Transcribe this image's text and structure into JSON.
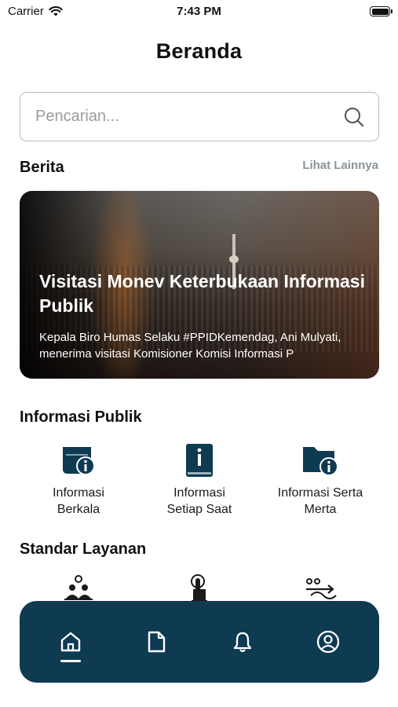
{
  "status_bar": {
    "carrier": "Carrier",
    "time": "7:43 PM"
  },
  "page": {
    "title": "Beranda"
  },
  "search": {
    "placeholder": "Pencarian..."
  },
  "news": {
    "section_title": "Berita",
    "see_more": "Lihat Lainnya",
    "card": {
      "title": "Visitasi Monev Keterbukaan Informasi Publik",
      "summary": "Kepala Biro Humas Selaku #PPIDKemendag, Ani Mulyati, menerima visitasi Komisioner Komisi Informasi P"
    }
  },
  "public_info": {
    "section_title": "Informasi Publik",
    "items": [
      {
        "label": "Informasi\nBerkala",
        "icon": "calendar-info-icon"
      },
      {
        "label": "Informasi\nSetiap Saat",
        "icon": "book-info-icon"
      },
      {
        "label": "Informasi Serta\nMerta",
        "icon": "folder-info-icon"
      }
    ]
  },
  "service_standard": {
    "section_title": "Standar Layanan",
    "items": [
      {
        "icon": "people-clock-icon"
      },
      {
        "icon": "touch-pointer-icon"
      },
      {
        "icon": "flow-arrows-icon"
      }
    ]
  },
  "bottom_nav": {
    "items": [
      {
        "icon": "home-icon",
        "active": true
      },
      {
        "icon": "document-icon"
      },
      {
        "icon": "bell-icon"
      },
      {
        "icon": "profile-icon"
      }
    ]
  },
  "colors": {
    "nav_background": "#0e3a52",
    "icon_dark": "#0e3a52",
    "link_gray": "#8a939c"
  }
}
